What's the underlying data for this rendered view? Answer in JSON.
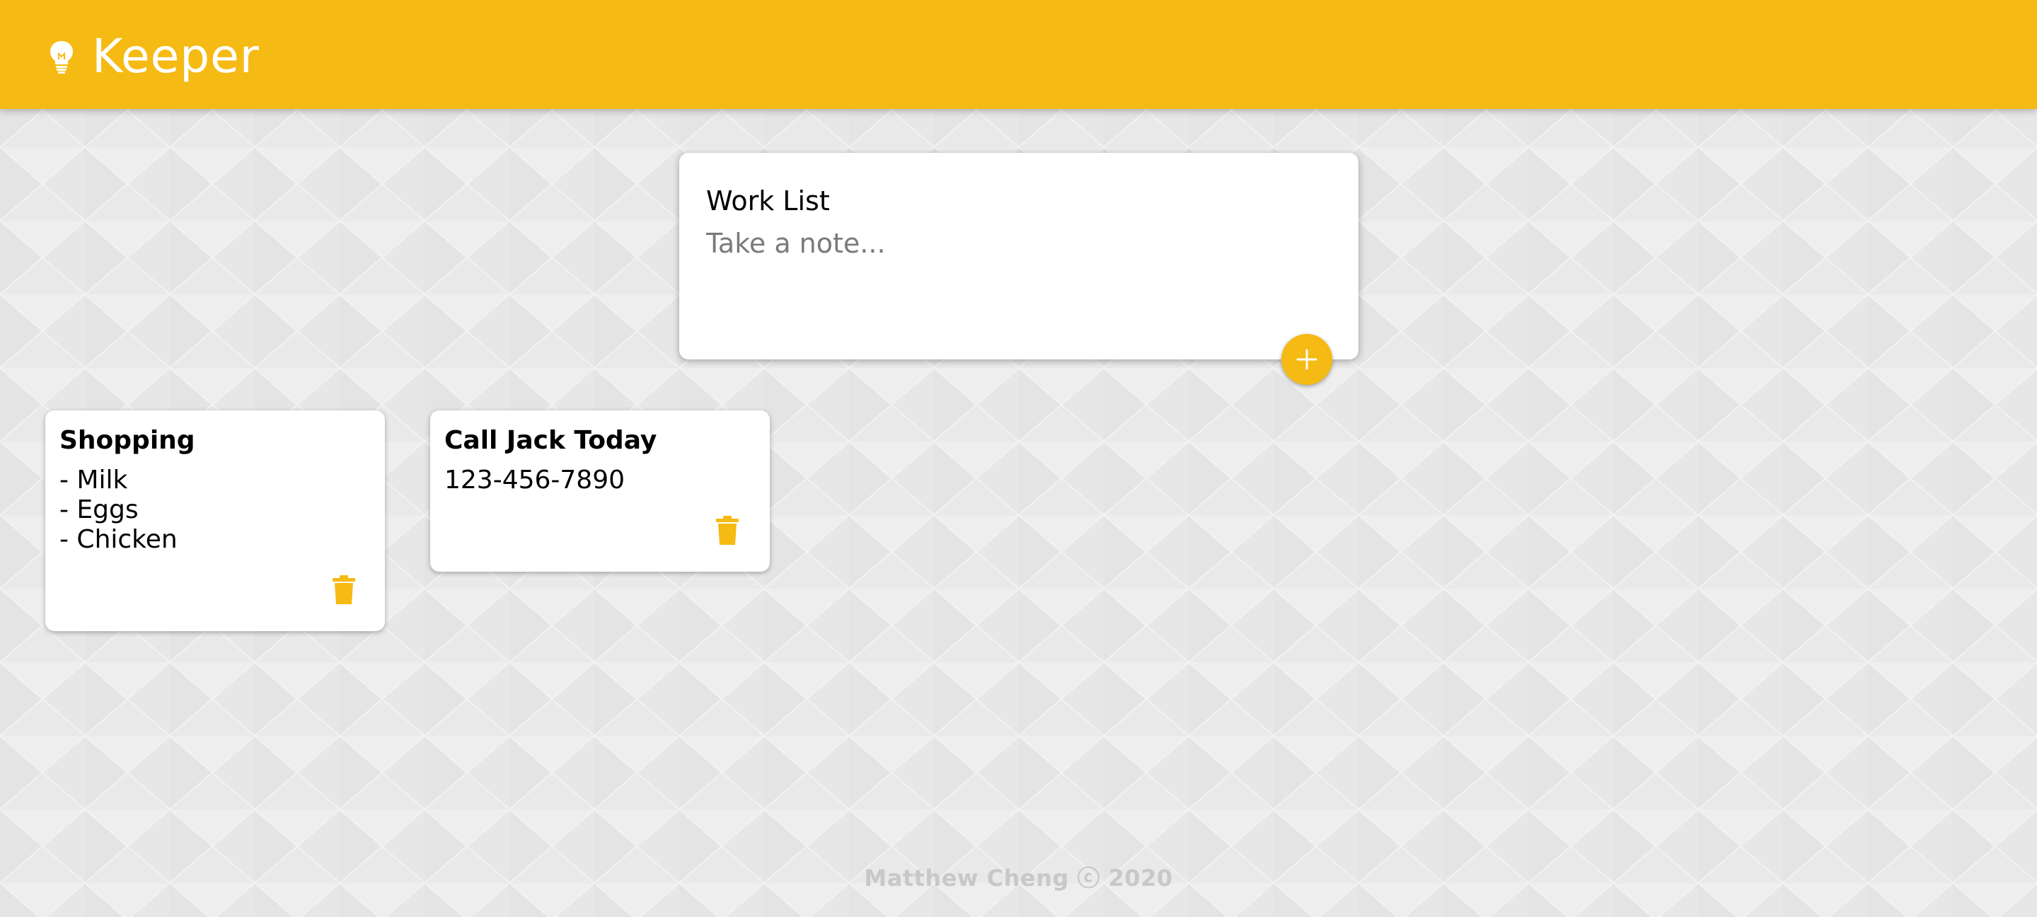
{
  "header": {
    "title": "Keeper"
  },
  "create_area": {
    "title_value": "Work List",
    "content_placeholder": "Take a note...",
    "add_icon": "plus-icon"
  },
  "notes": [
    {
      "title": "Shopping",
      "content": "- Milk\n- Eggs\n- Chicken",
      "delete_icon": "trash-icon"
    },
    {
      "title": "Call Jack Today",
      "content": "123-456-7890",
      "delete_icon": "trash-icon"
    }
  ],
  "footer": {
    "text": "Matthew Cheng ⓒ 2020"
  },
  "colors": {
    "accent": "#f5ba13",
    "background": "#ebebeb",
    "card": "#ffffff",
    "footer_text": "#c8c8c8"
  }
}
